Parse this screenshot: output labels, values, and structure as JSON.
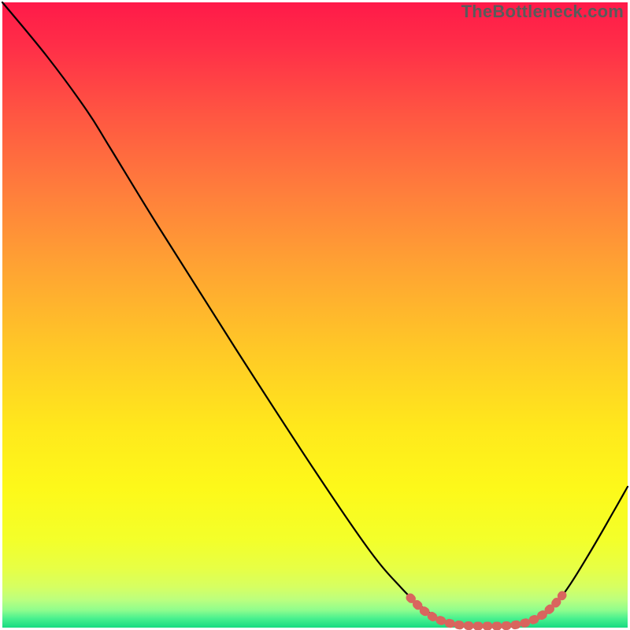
{
  "watermark": "TheBottleneck.com",
  "chart_data": {
    "type": "line",
    "title": "",
    "xlabel": "",
    "ylabel": "",
    "xlim": [
      3,
      797
    ],
    "ylim": [
      797,
      3
    ],
    "annotations": [],
    "background_gradient": {
      "stops": [
        {
          "offset": 0.0,
          "color": "#ff1a49"
        },
        {
          "offset": 0.07,
          "color": "#ff2e48"
        },
        {
          "offset": 0.18,
          "color": "#ff5642"
        },
        {
          "offset": 0.3,
          "color": "#ff7d3c"
        },
        {
          "offset": 0.42,
          "color": "#ffa233"
        },
        {
          "offset": 0.55,
          "color": "#ffc727"
        },
        {
          "offset": 0.68,
          "color": "#ffe81c"
        },
        {
          "offset": 0.78,
          "color": "#fdf91a"
        },
        {
          "offset": 0.86,
          "color": "#f3ff2a"
        },
        {
          "offset": 0.905,
          "color": "#e7ff45"
        },
        {
          "offset": 0.935,
          "color": "#d6ff62"
        },
        {
          "offset": 0.955,
          "color": "#bcff7e"
        },
        {
          "offset": 0.972,
          "color": "#8ffd8d"
        },
        {
          "offset": 0.985,
          "color": "#4af18f"
        },
        {
          "offset": 1.0,
          "color": "#18db82"
        }
      ]
    },
    "series": [
      {
        "name": "bottleneck-curve",
        "stroke": "#000000",
        "stroke_width": 2.2,
        "points": [
          {
            "x": 3,
            "y": 3
          },
          {
            "x": 60,
            "y": 72
          },
          {
            "x": 110,
            "y": 140
          },
          {
            "x": 140,
            "y": 188
          },
          {
            "x": 200,
            "y": 286
          },
          {
            "x": 300,
            "y": 444
          },
          {
            "x": 400,
            "y": 598
          },
          {
            "x": 470,
            "y": 700
          },
          {
            "x": 510,
            "y": 747
          },
          {
            "x": 530,
            "y": 766
          },
          {
            "x": 548,
            "y": 780
          },
          {
            "x": 565,
            "y": 789
          },
          {
            "x": 590,
            "y": 794
          },
          {
            "x": 620,
            "y": 795
          },
          {
            "x": 650,
            "y": 794
          },
          {
            "x": 672,
            "y": 790
          },
          {
            "x": 695,
            "y": 778
          },
          {
            "x": 720,
            "y": 748
          },
          {
            "x": 750,
            "y": 700
          },
          {
            "x": 780,
            "y": 648
          },
          {
            "x": 797,
            "y": 618
          }
        ]
      },
      {
        "name": "valley-band",
        "stroke": "#d9655e",
        "stroke_width": 11,
        "dash": "2 10",
        "linecap": "round",
        "points": [
          {
            "x": 521,
            "y": 759
          },
          {
            "x": 536,
            "y": 774
          },
          {
            "x": 552,
            "y": 785
          },
          {
            "x": 568,
            "y": 791
          },
          {
            "x": 585,
            "y": 794
          },
          {
            "x": 602,
            "y": 795
          },
          {
            "x": 619,
            "y": 795
          },
          {
            "x": 636,
            "y": 795
          },
          {
            "x": 652,
            "y": 794
          },
          {
            "x": 667,
            "y": 791
          },
          {
            "x": 680,
            "y": 786
          },
          {
            "x": 692,
            "y": 779
          },
          {
            "x": 704,
            "y": 768
          },
          {
            "x": 714,
            "y": 756
          }
        ]
      }
    ]
  }
}
